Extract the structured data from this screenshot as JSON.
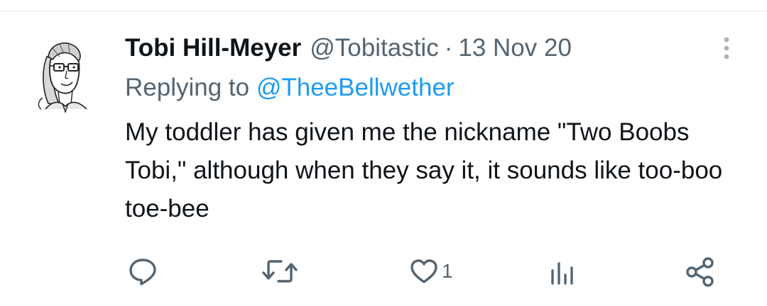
{
  "tweet": {
    "display_name": "Tobi Hill-Meyer",
    "handle": "@Tobitastic",
    "separator": "·",
    "date": "13 Nov 20",
    "replying_prefix": "Replying to",
    "replying_to": "@TheeBellwether",
    "text": "My toddler has given me the nickname \"Two Boobs Tobi,\" although when they say it, it sounds like too-boo toe-bee"
  },
  "actions": {
    "reply_icon": "reply-icon",
    "retweet_icon": "retweet-icon",
    "like_icon": "heart-icon",
    "like_count": "1",
    "views_icon": "views-icon",
    "share_icon": "share-icon"
  },
  "colors": {
    "accent": "#1d9bf0",
    "text_primary": "#0f1419",
    "text_secondary": "#536471",
    "icon_gray": "#536471"
  }
}
